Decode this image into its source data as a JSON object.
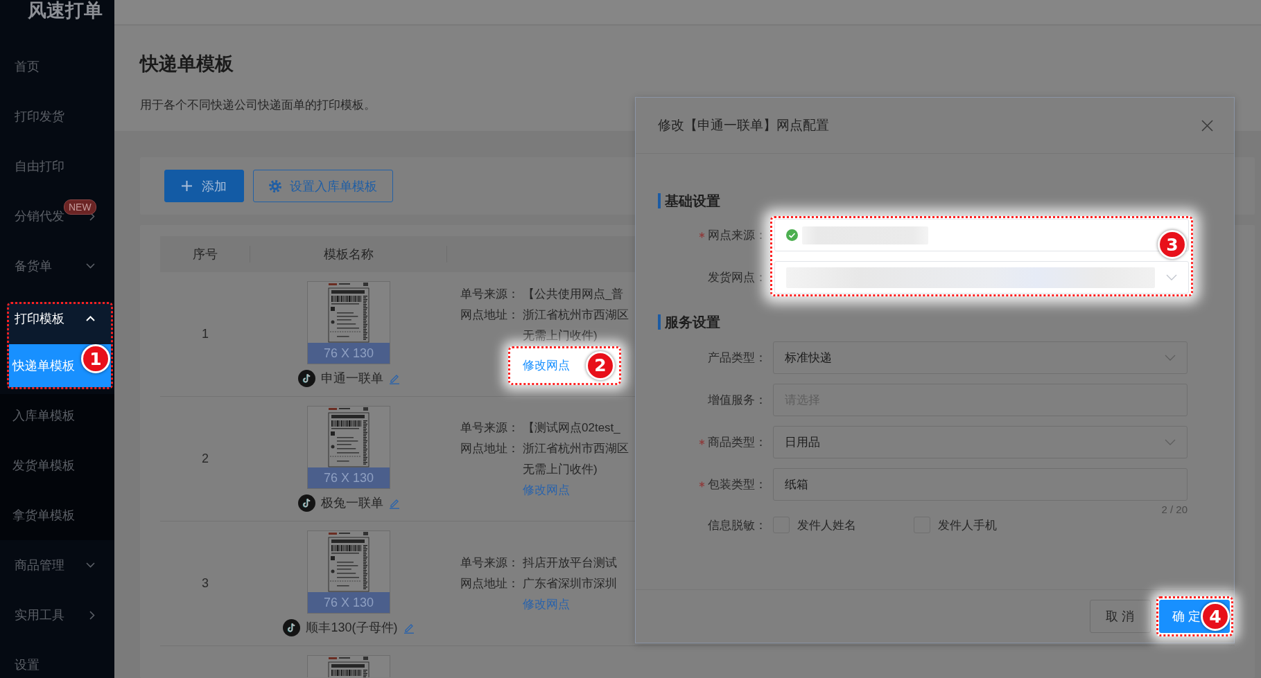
{
  "sidebar": {
    "logo": "风速打单",
    "items": [
      {
        "label": "首页",
        "kind": "link",
        "selected": false
      },
      {
        "label": "打印发货",
        "kind": "link",
        "selected": false
      },
      {
        "label": "自由打印",
        "kind": "link",
        "selected": false
      },
      {
        "label": "分销代发",
        "kind": "flyout",
        "selected": false,
        "badge": "NEW"
      },
      {
        "label": "备货单",
        "kind": "group",
        "expanded": false,
        "selected": false
      },
      {
        "label": "打印模板",
        "kind": "group",
        "expanded": true,
        "selected": false,
        "callout": "1",
        "children": [
          {
            "label": "快递单模板",
            "selected": true
          },
          {
            "label": "入库单模板",
            "selected": false
          },
          {
            "label": "发货单模板",
            "selected": false
          },
          {
            "label": "拿货单模板",
            "selected": false
          }
        ]
      },
      {
        "label": "商品管理",
        "kind": "group",
        "expanded": false,
        "selected": false
      },
      {
        "label": "实用工具",
        "kind": "flyout",
        "selected": false
      },
      {
        "label": "设置",
        "kind": "link",
        "selected": false
      }
    ]
  },
  "page": {
    "title": "快递单模板",
    "description": "用于各个不同快递公司快递面单的打印模板。"
  },
  "toolbar": {
    "buttons": [
      {
        "label": "添加",
        "kind": "primary"
      },
      {
        "label": "设置入库单模板",
        "kind": "outline"
      }
    ]
  },
  "table": {
    "columns": [
      {
        "label": "序号"
      },
      {
        "label": "模板名称"
      }
    ],
    "rows": [
      {
        "index": "1",
        "template": "申通一联单",
        "size": "76 X 130",
        "details": [
          {
            "label": "单号来源：",
            "lines": [
              "【公共使用网点_普"
            ]
          },
          {
            "label": "网点地址：",
            "lines": [
              "浙江省杭州市西湖区",
              "无需上门收件)"
            ]
          }
        ],
        "link": "修改网点",
        "callout": "2"
      },
      {
        "index": "2",
        "template": "极兔一联单",
        "size": "76 X 130",
        "details": [
          {
            "label": "单号来源：",
            "lines": [
              "【测试网点02test_"
            ]
          },
          {
            "label": "网点地址：",
            "lines": [
              "浙江省杭州市西湖区",
              "无需上门收件)"
            ]
          }
        ],
        "link": "修改网点"
      },
      {
        "index": "3",
        "template": "顺丰130(子母件)",
        "size": "76 X 130",
        "details": [
          {
            "label": "单号来源：",
            "lines": [
              "抖店开放平台测试"
            ]
          },
          {
            "label": "网点地址：",
            "lines": [
              "广东省深圳市深圳"
            ]
          }
        ],
        "link": "修改网点"
      }
    ],
    "next_row_partial": true
  },
  "dialog": {
    "title": "修改【申通一联单】网点配置",
    "sections": [
      {
        "title": "基础设置",
        "callout": "3",
        "fields": [
          {
            "label": "网点来源：",
            "required": true,
            "kind": "input",
            "verified": true,
            "redacted": true
          },
          {
            "label": "发货网点：",
            "required": false,
            "kind": "select",
            "verified": false,
            "redacted": true
          }
        ]
      },
      {
        "title": "服务设置",
        "fields": [
          {
            "label": "产品类型：",
            "required": false,
            "kind": "select",
            "value": "标准快递"
          },
          {
            "label": "增值服务：",
            "required": false,
            "kind": "input",
            "placeholder": "请选择"
          },
          {
            "label": "商品类型：",
            "required": true,
            "kind": "select",
            "value": "日用品"
          },
          {
            "label": "包装类型：",
            "required": true,
            "kind": "input",
            "value": "纸箱",
            "counter": "2 / 20"
          },
          {
            "label": "信息脱敏：",
            "required": false,
            "kind": "checkboxes",
            "options": [
              {
                "label": "发件人姓名",
                "checked": false
              },
              {
                "label": "发件人手机",
                "checked": false
              }
            ]
          }
        ]
      }
    ],
    "buttons": [
      {
        "label": "取 消",
        "kind": "secondary"
      },
      {
        "label": "确 定",
        "kind": "primary",
        "callout": "4"
      }
    ]
  }
}
